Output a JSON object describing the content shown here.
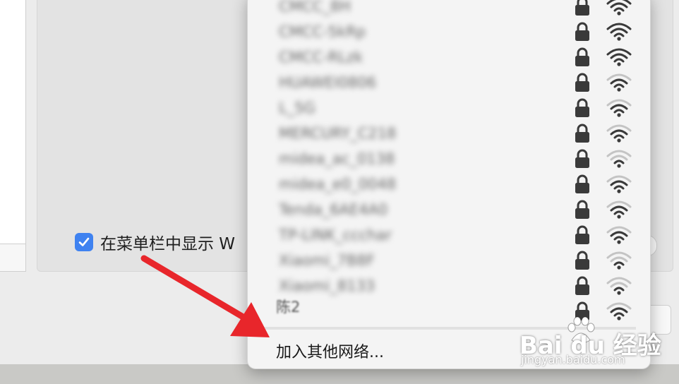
{
  "settings": {
    "show_in_menubar_label": "在菜单栏中显示 W",
    "show_in_menubar_checked": true
  },
  "wifi_menu": {
    "networks": [
      {
        "name": "CMCC_8H",
        "secured": true,
        "signal": 3
      },
      {
        "name": "CMCC-5kRp",
        "secured": true,
        "signal": 3
      },
      {
        "name": "CMCC-RLzk",
        "secured": true,
        "signal": 3
      },
      {
        "name": "HUAWEI0806",
        "secured": true,
        "signal": 2
      },
      {
        "name": "L_5G",
        "secured": true,
        "signal": 2
      },
      {
        "name": "MERCURY_C218",
        "secured": true,
        "signal": 2
      },
      {
        "name": "midea_ac_0138",
        "secured": true,
        "signal": 1
      },
      {
        "name": "midea_e0_0048",
        "secured": true,
        "signal": 2
      },
      {
        "name": "Tenda_6AE4A0",
        "secured": true,
        "signal": 2
      },
      {
        "name": "TP-LINK_ccchar",
        "secured": true,
        "signal": 2
      },
      {
        "name": "Xiaomi_7B8F",
        "secured": true,
        "signal": 1
      },
      {
        "name": "Xiaomi_8133",
        "secured": true,
        "signal": 1
      },
      {
        "name": "陈2",
        "secured": true,
        "signal": 2
      }
    ],
    "join_other_label": "加入其他网络..."
  },
  "watermark": {
    "logo": "Bai du 经验",
    "url": "jingyan.baidu.com"
  },
  "colors": {
    "accent": "#3f82f0",
    "arrow": "#e8262b"
  }
}
